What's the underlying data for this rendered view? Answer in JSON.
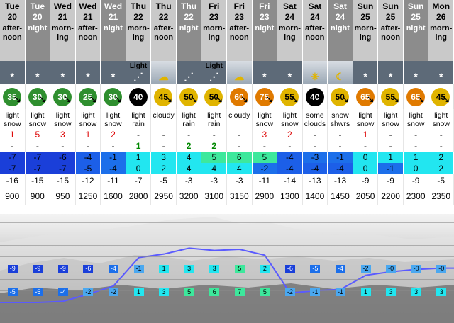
{
  "columns": [
    {
      "day": "Tue",
      "date": "20",
      "period": "after-\nnoon"
    },
    {
      "day": "Tue",
      "date": "20",
      "period": "night"
    },
    {
      "day": "Wed",
      "date": "21",
      "period": "morn-\ning"
    },
    {
      "day": "Wed",
      "date": "21",
      "period": "after-\nnoon"
    },
    {
      "day": "Wed",
      "date": "21",
      "period": "night"
    },
    {
      "day": "Thu",
      "date": "22",
      "period": "morn-\ning"
    },
    {
      "day": "Thu",
      "date": "22",
      "period": "after-\nnoon"
    },
    {
      "day": "Thu",
      "date": "22",
      "period": "night"
    },
    {
      "day": "Fri",
      "date": "23",
      "period": "morn-\ning"
    },
    {
      "day": "Fri",
      "date": "23",
      "period": "after-\nnoon"
    },
    {
      "day": "Fri",
      "date": "23",
      "period": "night"
    },
    {
      "day": "Sat",
      "date": "24",
      "period": "morn-\ning"
    },
    {
      "day": "Sat",
      "date": "24",
      "period": "after-\nnoon"
    },
    {
      "day": "Sat",
      "date": "24",
      "period": "night"
    },
    {
      "day": "Sun",
      "date": "25",
      "period": "morn-\ning"
    },
    {
      "day": "Sun",
      "date": "25",
      "period": "after-\nnoon"
    },
    {
      "day": "Sun",
      "date": "25",
      "period": "night"
    },
    {
      "day": "Mon",
      "date": "26",
      "period": "morn-\ning"
    }
  ],
  "dark_header_columns": [
    1,
    4,
    7,
    10,
    13,
    16
  ],
  "sky_icons": [
    "snow-cloud-icon",
    "snow-cloud-icon",
    "snow-cloud-icon",
    "snow-cloud-icon",
    "snow-cloud-icon",
    "light-rain-icon",
    "cloud-icon",
    "rain-cloud-icon",
    "light-rain-icon",
    "cloud-icon",
    "snow-cloud-icon",
    "snow-cloud-icon",
    "sun-cloud-icon",
    "moon-cloud-icon",
    "snow-cloud-icon",
    "snow-cloud-icon",
    "snow-cloud-icon",
    "snow-cloud-icon"
  ],
  "sky_labels": [
    "",
    "",
    "",
    "",
    "",
    "Light",
    "",
    "",
    "Light",
    "",
    "",
    "",
    "",
    "",
    "",
    "",
    "",
    ""
  ],
  "wind_speeds": [
    "35",
    "30",
    "30",
    "25",
    "30",
    "40",
    "45",
    "50",
    "50",
    "60",
    "75",
    "55",
    "40",
    "50",
    "65",
    "55",
    "65",
    "45"
  ],
  "wind_colors": [
    "#2f8f2f",
    "#2f8f2f",
    "#2f8f2f",
    "#2f8f2f",
    "#2f8f2f",
    "#000000",
    "#e0b400",
    "#e0b400",
    "#e0b400",
    "#e07a00",
    "#e07a00",
    "#e0b400",
    "#000000",
    "#e0b400",
    "#e07a00",
    "#e0b400",
    "#e07a00",
    "#e0b400"
  ],
  "summary": [
    "light\nsnow",
    "light\nsnow",
    "light\nsnow",
    "light\nsnow",
    "light\nsnow",
    "light\nrain",
    "cloudy",
    "light\nrain",
    "light\nrain",
    "cloudy",
    "light\nsnow",
    "light\nsnow",
    "some\nclouds",
    "snow\nshwrs",
    "light\nsnow",
    "light\nsnow",
    "light\nsnow",
    "light\nsnow"
  ],
  "snow_row": [
    "1",
    "5",
    "3",
    "1",
    "2",
    "-",
    "-",
    "-",
    "-",
    "-",
    "3",
    "2",
    "-",
    "-",
    "1",
    "-",
    "-",
    "-"
  ],
  "rain_row": [
    "-",
    "-",
    "-",
    "-",
    "-",
    "1",
    "-",
    "2",
    "2",
    "-",
    "-",
    "-",
    "-",
    "-",
    "-",
    "-",
    "-",
    "-"
  ],
  "max_temp": [
    "-7",
    "-7",
    "-6",
    "-4",
    "-1",
    "1",
    "3",
    "4",
    "5",
    "6",
    "5",
    "-4",
    "-3",
    "-1",
    "0",
    "1",
    "1",
    "2"
  ],
  "min_temp": [
    "-7",
    "-7",
    "-7",
    "-5",
    "-4",
    "0",
    "2",
    "4",
    "4",
    "4",
    "-2",
    "-4",
    "-4",
    "-4",
    "0",
    "-1",
    "0",
    "2"
  ],
  "temp_colors_max": [
    "#1a3fd9",
    "#1a3fd9",
    "#1a3fd9",
    "#1c5fe8",
    "#1c6fea",
    "#22e6f0",
    "#22e6f0",
    "#22e6f0",
    "#3de89c",
    "#3de89c",
    "#3de89c",
    "#1c5fe8",
    "#1c6fea",
    "#1c6fea",
    "#22e6f0",
    "#22e6f0",
    "#22e6f0",
    "#22e6f0"
  ],
  "temp_colors_min": [
    "#1a3fd9",
    "#1a3fd9",
    "#1a3fd9",
    "#1c5fe8",
    "#1c6fea",
    "#22e6f0",
    "#22e6f0",
    "#22e6f0",
    "#22e6f0",
    "#22e6f0",
    "#1c6fea",
    "#1c5fe8",
    "#1c5fe8",
    "#1c5fe8",
    "#22e6f0",
    "#1c6fea",
    "#22e6f0",
    "#22e6f0"
  ],
  "chill": [
    "-16",
    "-15",
    "-15",
    "-12",
    "-11",
    "-7",
    "-5",
    "-3",
    "-3",
    "-3",
    "-11",
    "-14",
    "-13",
    "-13",
    "-9",
    "-9",
    "-9",
    "-5"
  ],
  "freezing_level": [
    "900",
    "900",
    "950",
    "1250",
    "1600",
    "2800",
    "2950",
    "3200",
    "3100",
    "3150",
    "2900",
    "1300",
    "1400",
    "1450",
    "2050",
    "2200",
    "2300",
    "2350"
  ],
  "chart_panel": {
    "top_badges": [
      "-9",
      "-9",
      "-9",
      "-6",
      "-4",
      "-1",
      "1",
      "3",
      "3",
      "5",
      "2",
      "-6",
      "-5",
      "-4",
      "-2",
      "-0",
      "-0",
      "-0"
    ],
    "bottom_badges": [
      "-5",
      "-5",
      "-4",
      "-2",
      "-2",
      "1",
      "3",
      "5",
      "6",
      "7",
      "5",
      "-2",
      "-1",
      "-1",
      "1",
      "3",
      "3",
      "3"
    ],
    "freezing_level_series": [
      900,
      900,
      950,
      1250,
      1600,
      2800,
      2950,
      3200,
      3100,
      3150,
      2900,
      1300,
      1400,
      1450,
      2050,
      2200,
      2300,
      2350
    ],
    "line_color": "#5a5aff"
  }
}
